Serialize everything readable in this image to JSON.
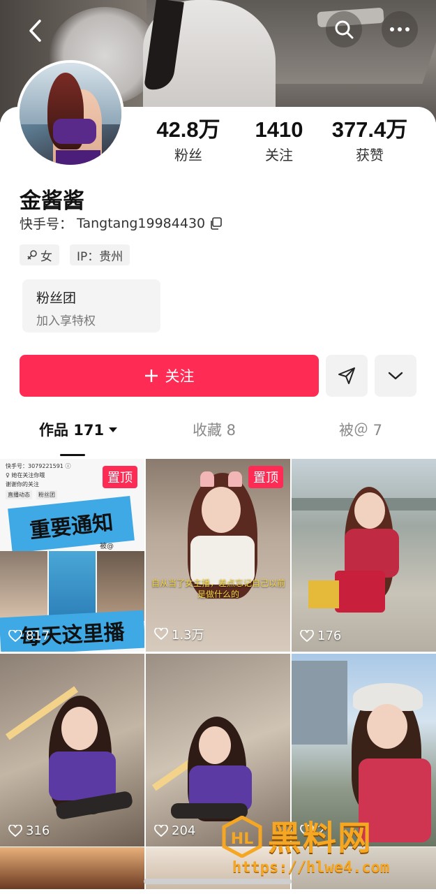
{
  "header": {
    "back_icon": "chevron-left-icon",
    "search_icon": "search-icon",
    "more_icon": "more-dots-icon"
  },
  "profile": {
    "name": "金酱酱",
    "id_label": "快手号：",
    "id_value": "Tangtang19984430",
    "gender_tag": "女",
    "ip_tag": "IP：贵州"
  },
  "stats": [
    {
      "value": "42.8万",
      "label": "粉丝"
    },
    {
      "value": "1410",
      "label": "关注"
    },
    {
      "value": "377.4万",
      "label": "获赞"
    }
  ],
  "fan_club": {
    "title": "粉丝团",
    "subtitle": "加入享特权"
  },
  "actions": {
    "follow_label": "关注"
  },
  "tabs": [
    {
      "label": "作品 171"
    },
    {
      "label": "收藏 8"
    },
    {
      "label": "被＠ 7"
    }
  ],
  "grid": [
    {
      "likes": "817",
      "pinned": true,
      "pin_label": "置顶",
      "doc_lines": [
        "快手号：3079221591 ⓘ",
        "♀ 她在关注你哦",
        "谢谢你的关注"
      ],
      "mini_tags": [
        "直播动态",
        "粉丝团"
      ],
      "banner_top": "重要通知",
      "banner_bottom": "每天这里播",
      "small_text": "被@"
    },
    {
      "likes": "1.3万",
      "pinned": true,
      "pin_label": "置顶",
      "caption": "自从当了女主播，差点忘记自己以前是做什么的"
    },
    {
      "likes": "176",
      "pinned": false
    },
    {
      "likes": "316",
      "pinned": false
    },
    {
      "likes": "204",
      "pinned": false
    },
    {
      "likes": "2",
      "pinned": false
    }
  ],
  "watermark": {
    "brand": "黑料网",
    "url": "https://hlwe4.com"
  }
}
